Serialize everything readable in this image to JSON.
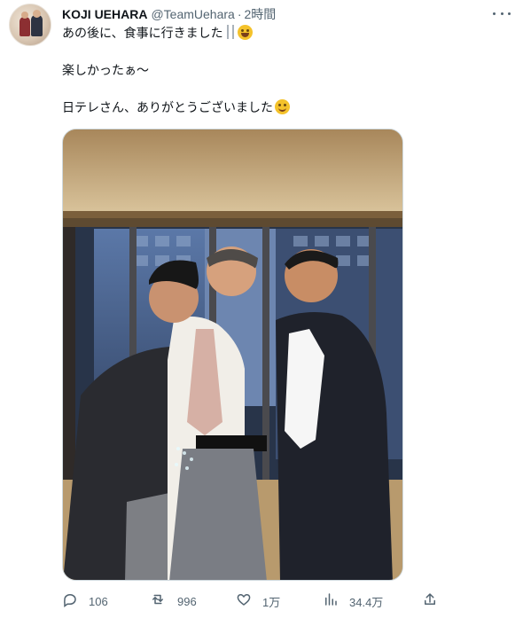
{
  "tweet": {
    "author_name": "KOJI UEHARA",
    "handle": "@TeamUehara",
    "separator": "·",
    "time": "2時間",
    "lines": [
      "あの後に、食事に行きました",
      "楽しかったぁ～",
      "日テレさん、ありがとうございました"
    ]
  },
  "icons": {
    "avatar": "avatar",
    "more": "more-icon",
    "utensils": "fork-knife-icon",
    "grin": "grinning-face-icon",
    "smile": "smiling-face-icon",
    "reply": "reply-icon",
    "retweet": "retweet-icon",
    "like": "heart-icon",
    "views": "views-chart-icon",
    "share": "share-icon"
  },
  "metrics": {
    "replies": "106",
    "retweets": "996",
    "likes": "1万",
    "views": "34.4万"
  },
  "colors": {
    "text": "#0f1419",
    "secondary": "#536471",
    "border": "#cfd9de"
  }
}
